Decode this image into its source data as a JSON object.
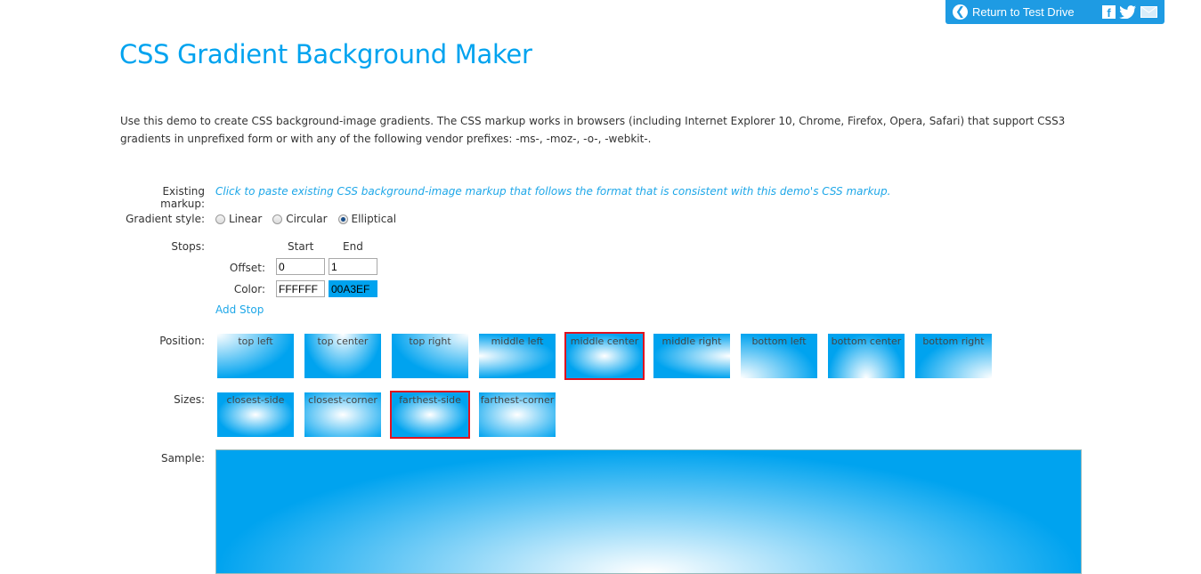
{
  "topbar": {
    "return_label": "Return to Test Drive",
    "icons": [
      "back-arrow-icon",
      "facebook-icon",
      "twitter-icon",
      "email-icon"
    ]
  },
  "page": {
    "title": "CSS Gradient Background Maker",
    "intro": "Use this demo to create CSS background-image gradients. The CSS markup works in browsers (including Internet Explorer 10, Chrome, Firefox, Opera, Safari) that support CSS3 gradients in unprefixed form or with any of the following vendor prefixes: -ms-, -moz-, -o-, -webkit-."
  },
  "form": {
    "existing_markup_label": "Existing markup:",
    "existing_markup_link": "Click to paste existing CSS background-image markup that follows the format that is consistent with this demo's CSS markup.",
    "gradient_style_label": "Gradient style:",
    "gradient_styles": [
      {
        "label": "Linear",
        "checked": false
      },
      {
        "label": "Circular",
        "checked": false
      },
      {
        "label": "Elliptical",
        "checked": true
      }
    ],
    "stops_label": "Stops:",
    "stops_columns": [
      "Start",
      "End"
    ],
    "offset_label": "Offset:",
    "color_label": "Color:",
    "stops": [
      {
        "offset": "0",
        "color": "FFFFFF",
        "color_hex": "#FFFFFF"
      },
      {
        "offset": "1",
        "color": "00A3EF",
        "color_hex": "#00A3EF"
      }
    ],
    "add_stop_label": "Add Stop",
    "position_label": "Position:",
    "positions": [
      {
        "label": "top left",
        "selected": false
      },
      {
        "label": "top center",
        "selected": false
      },
      {
        "label": "top right",
        "selected": false
      },
      {
        "label": "middle left",
        "selected": false
      },
      {
        "label": "middle center",
        "selected": true
      },
      {
        "label": "middle right",
        "selected": false
      },
      {
        "label": "bottom left",
        "selected": false
      },
      {
        "label": "bottom center",
        "selected": false
      },
      {
        "label": "bottom right",
        "selected": false
      }
    ],
    "sizes_label": "Sizes:",
    "sizes": [
      {
        "label": "closest-side",
        "selected": false
      },
      {
        "label": "closest-corner",
        "selected": false
      },
      {
        "label": "farthest-side",
        "selected": true
      },
      {
        "label": "farthest-corner",
        "selected": false
      }
    ],
    "sample_label": "Sample:"
  },
  "colors": {
    "accent": "#00A3EF",
    "topbar": "#1E9BE3",
    "link": "#1EA7E8",
    "selected_border": "#E0121F"
  }
}
